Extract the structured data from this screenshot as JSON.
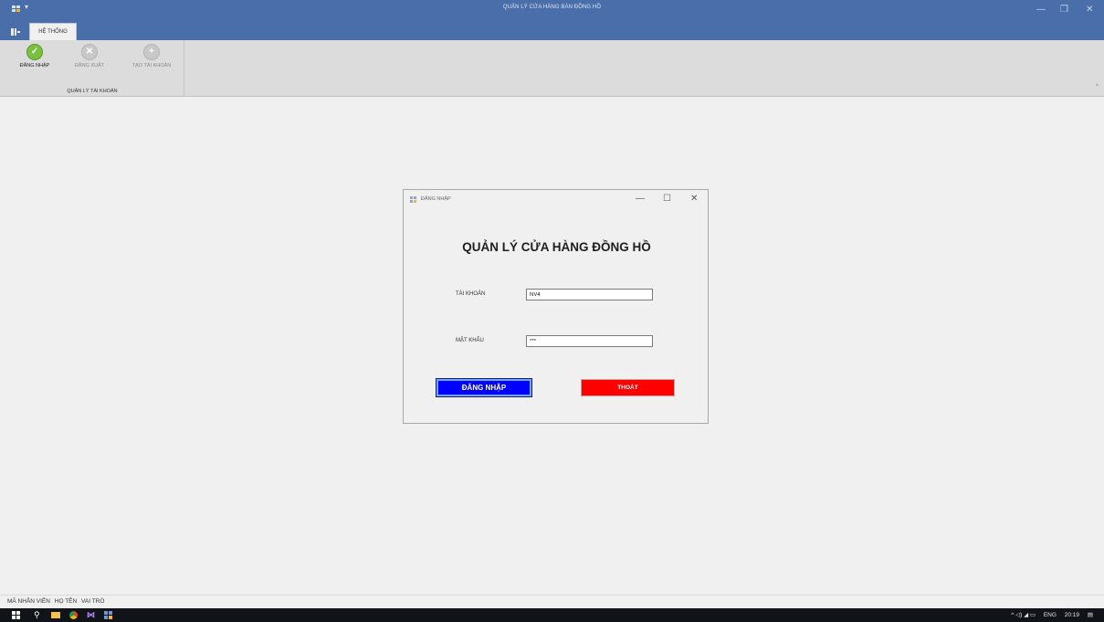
{
  "window": {
    "title": "QUẢN LÝ CỬA HÀNG BÁN ĐỒNG HỒ",
    "min_glyph": "—",
    "max_glyph": "❐",
    "close_glyph": "✕"
  },
  "ribbon": {
    "tab": "HỆ THỐNG",
    "group_label": "QUẢN LÝ TÀI KHOẢN",
    "buttons": [
      {
        "label": "ĐĂNG NHẬP",
        "icon": "check-icon",
        "glyph": "✓"
      },
      {
        "label": "ĐĂNG XUẤT",
        "icon": "x-circle-icon",
        "glyph": "✕"
      },
      {
        "label": "TẠO TÀI KHOẢN",
        "icon": "plus-circle-icon",
        "glyph": "+"
      }
    ],
    "collapse_glyph": "^"
  },
  "dialog": {
    "title": "ĐĂNG NHẬP",
    "heading": "QUẢN LÝ CỬA HÀNG ĐỒNG HỒ",
    "username_label": "TÀI KHOẢN",
    "username_value": "NV4",
    "password_label": "MẬT KHẨU",
    "password_value": "***",
    "login_button": "ĐĂNG NHẬP",
    "exit_button": "THOÁT",
    "min_glyph": "—",
    "max_glyph": "☐",
    "close_glyph": "✕"
  },
  "status": {
    "employee_id": "MÃ NHÂN VIÊN",
    "full_name": "HỌ TÊN",
    "role": "VAI TRÒ"
  },
  "taskbar": {
    "language": "ENG",
    "time": "20:19",
    "tray_glyphs": "^ ◁) ◢ ▭"
  },
  "colors": {
    "titlebar": "#4a6ea9",
    "login_button": "#0000ff",
    "exit_button": "#ff0000"
  }
}
